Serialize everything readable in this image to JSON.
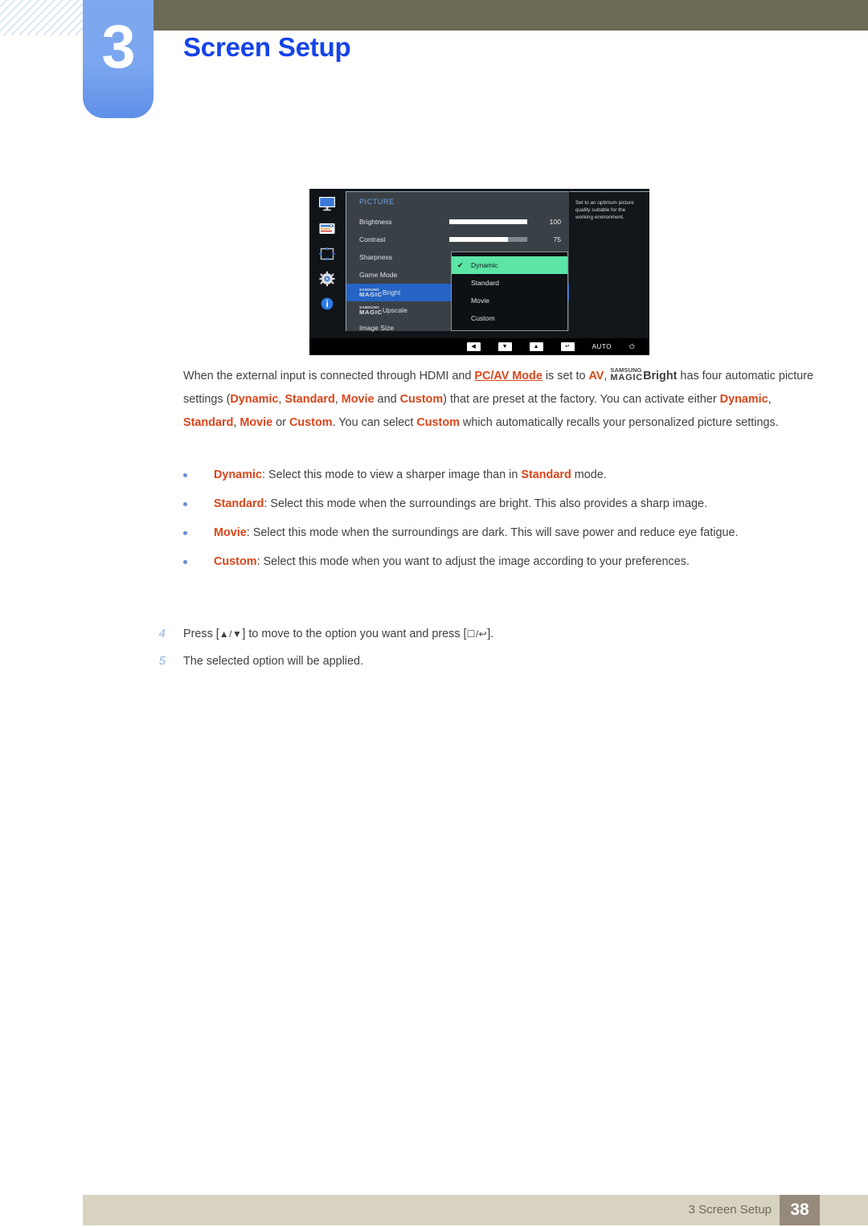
{
  "header": {
    "chapter_number": "3",
    "chapter_title": "Screen Setup"
  },
  "osd": {
    "heading": "PICTURE",
    "rail_icons": [
      "monitor-icon",
      "picture-icon",
      "position-icon",
      "gear-icon",
      "info-icon"
    ],
    "rows": [
      {
        "label": "Brightness",
        "value": "100",
        "slider": 100
      },
      {
        "label": "Contrast",
        "value": "75",
        "slider": 75
      },
      {
        "label": "Sharpness",
        "value": "",
        "slider": null
      },
      {
        "label": "Game Mode",
        "value": "",
        "slider": null
      }
    ],
    "magic_rows": [
      {
        "brand_top": "SAMSUNG",
        "brand_bottom": "MAGIC",
        "label": "Bright",
        "selected": true
      },
      {
        "brand_top": "SAMSUNG",
        "brand_bottom": "MAGIC",
        "label": "Upscale",
        "selected": false
      }
    ],
    "last_row": {
      "label": "Image Size"
    },
    "dropdown": {
      "check_glyph": "✔",
      "items": [
        {
          "label": "Dynamic",
          "active": true
        },
        {
          "label": "Standard",
          "active": false
        },
        {
          "label": "Movie",
          "active": false
        },
        {
          "label": "Custom",
          "active": false
        }
      ]
    },
    "tooltip": "Set to an optimum picture quality suitable for the working environment.",
    "buttons": [
      {
        "name": "left-key",
        "glyph": "◀"
      },
      {
        "name": "down-key",
        "glyph": "▼"
      },
      {
        "name": "up-key",
        "glyph": "▲"
      },
      {
        "name": "enter-key",
        "glyph": "↵"
      }
    ],
    "auto_label": "AUTO",
    "power_glyph": "⏻",
    "colors": {
      "highlight_green": "#5ce5a6",
      "selected_blue": "#2563c4",
      "panel_gray": "#3a4146",
      "background": "#12161a"
    }
  },
  "paragraph": {
    "p1": "When the external input is connected through HDMI and ",
    "link": "PC/AV Mode",
    "p2": " is set to ",
    "av": "AV",
    "p3": ", ",
    "brand_top": "SAMSUNG",
    "brand_bottom": "MAGIC",
    "bright": "Bright",
    "p4": " has four automatic picture settings (",
    "w1": "Dynamic",
    "c1": ", ",
    "w2": "Standard",
    "c2": ", ",
    "w3": "Movie",
    "c3": " and ",
    "w4": "Custom",
    "p5": ") that are preset at the factory. You can activate either ",
    "w5": "Dynamic",
    "c4": ", ",
    "w6": "Standard",
    "c5": ", ",
    "w7": "Movie",
    "c6": " or ",
    "w8": "Custom",
    "p6": ". You can select ",
    "w9": "Custom",
    "p7": " which automatically recalls your personalized picture settings."
  },
  "bullets": [
    {
      "term": "Dynamic",
      "text_a": ": Select this mode to view a sharper image than in ",
      "emph": "Standard",
      "text_b": " mode."
    },
    {
      "term": "Standard",
      "text_a": ": Select this mode when the surroundings are bright. This also provides a sharp image.",
      "emph": "",
      "text_b": ""
    },
    {
      "term": "Movie",
      "text_a": ": Select this mode when the surroundings are dark. This will save power and reduce eye fatigue.",
      "emph": "",
      "text_b": ""
    },
    {
      "term": "Custom",
      "text_a": ": Select this mode when you want to adjust the image according to your preferences.",
      "emph": "",
      "text_b": ""
    }
  ],
  "steps": [
    {
      "num": "4",
      "pre": "Press [",
      "keys": "▲/▼",
      "mid": "] to move to the option you want and press [",
      "keys2": "☐/↩",
      "post": "]."
    },
    {
      "num": "5",
      "pre": "The selected option will be applied.",
      "keys": "",
      "mid": "",
      "keys2": "",
      "post": ""
    }
  ],
  "footer": {
    "text": "3 Screen Setup",
    "page": "38"
  }
}
